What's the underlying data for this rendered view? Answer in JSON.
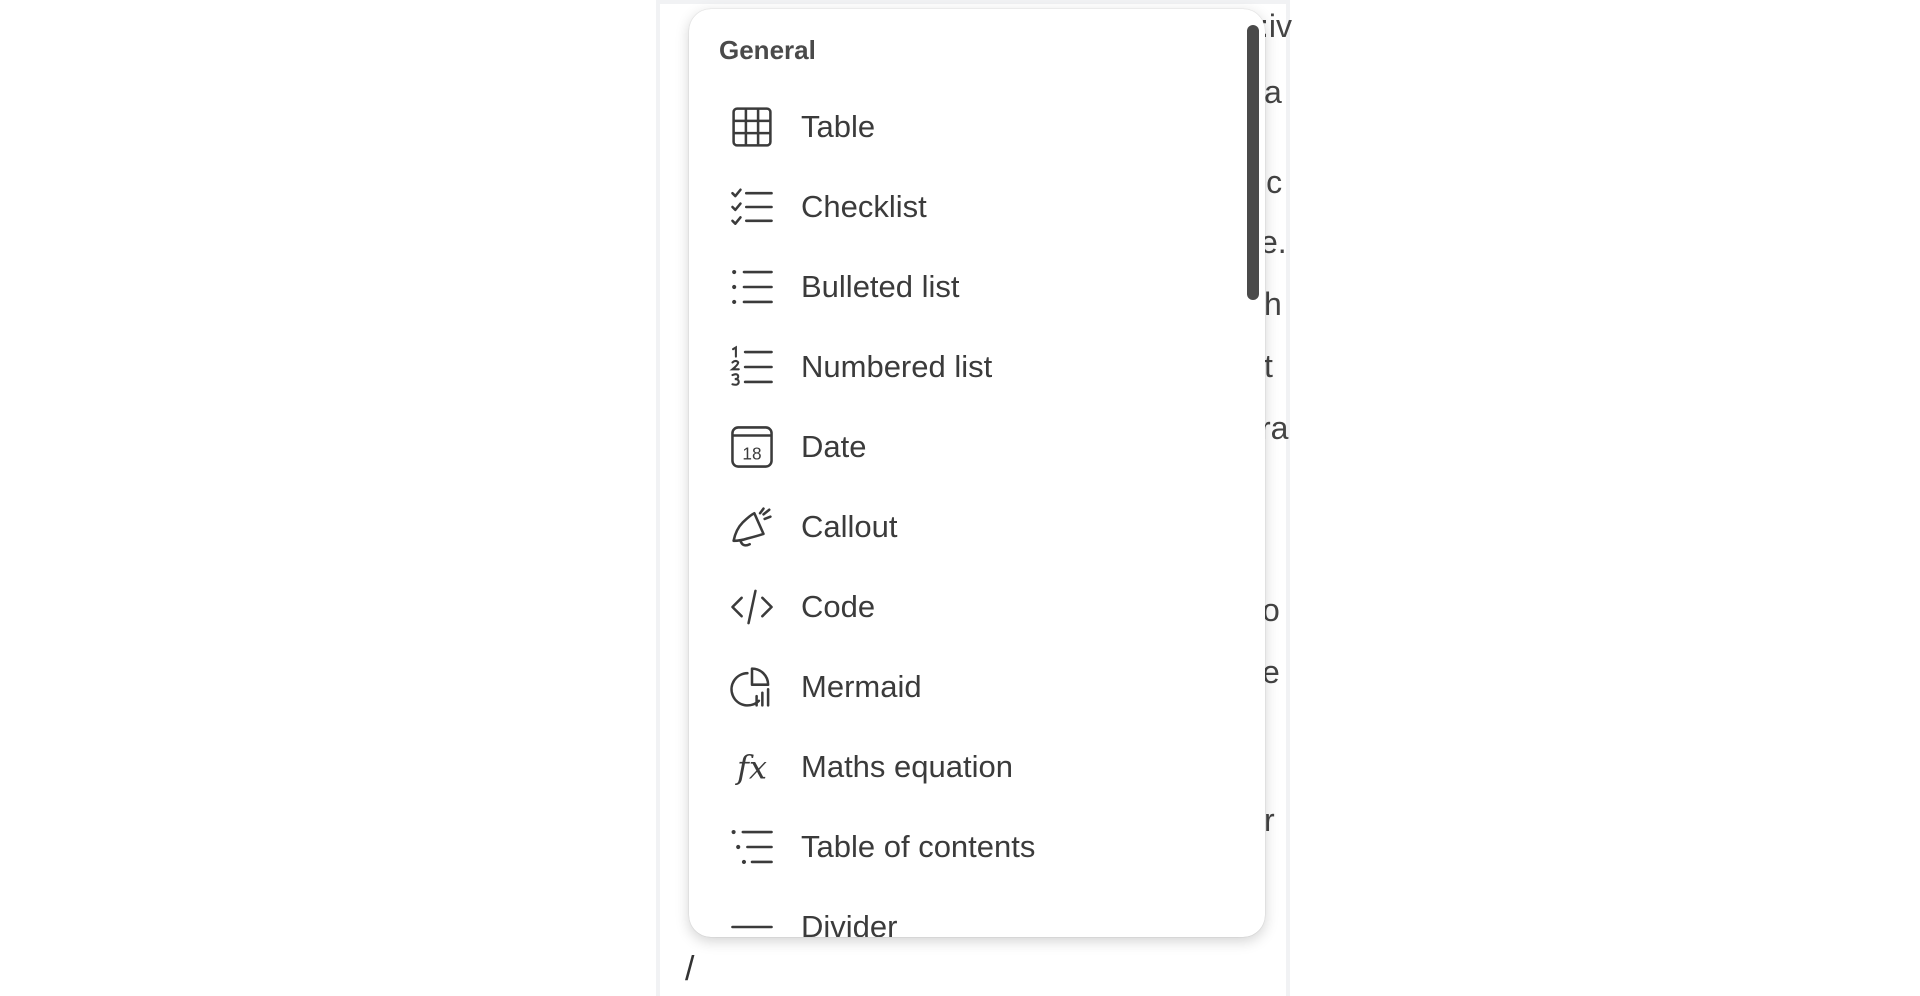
{
  "editor": {
    "slash_text": "/",
    "background_fragments": [
      ":iv",
      "a",
      "'c",
      "e.",
      "h",
      "t",
      "ra",
      "o",
      "e",
      "r"
    ]
  },
  "menu": {
    "section_title": "General",
    "items": [
      {
        "label": "Table",
        "icon": "table-icon"
      },
      {
        "label": "Checklist",
        "icon": "checklist-icon"
      },
      {
        "label": "Bulleted list",
        "icon": "bulleted-list-icon"
      },
      {
        "label": "Numbered list",
        "icon": "numbered-list-icon"
      },
      {
        "label": "Date",
        "icon": "calendar-date-icon",
        "icon_text": "18"
      },
      {
        "label": "Callout",
        "icon": "megaphone-icon"
      },
      {
        "label": "Code",
        "icon": "code-icon"
      },
      {
        "label": "Mermaid",
        "icon": "mermaid-chart-icon"
      },
      {
        "label": "Maths equation",
        "icon": "fx-icon",
        "icon_text": "fx"
      },
      {
        "label": "Table of contents",
        "icon": "table-of-contents-icon"
      },
      {
        "label": "Divider",
        "icon": "divider-icon"
      }
    ]
  },
  "colors": {
    "text": "#3b3b3b",
    "scrollbar": "#4a4a4a",
    "panel_background": "#ffffff"
  }
}
